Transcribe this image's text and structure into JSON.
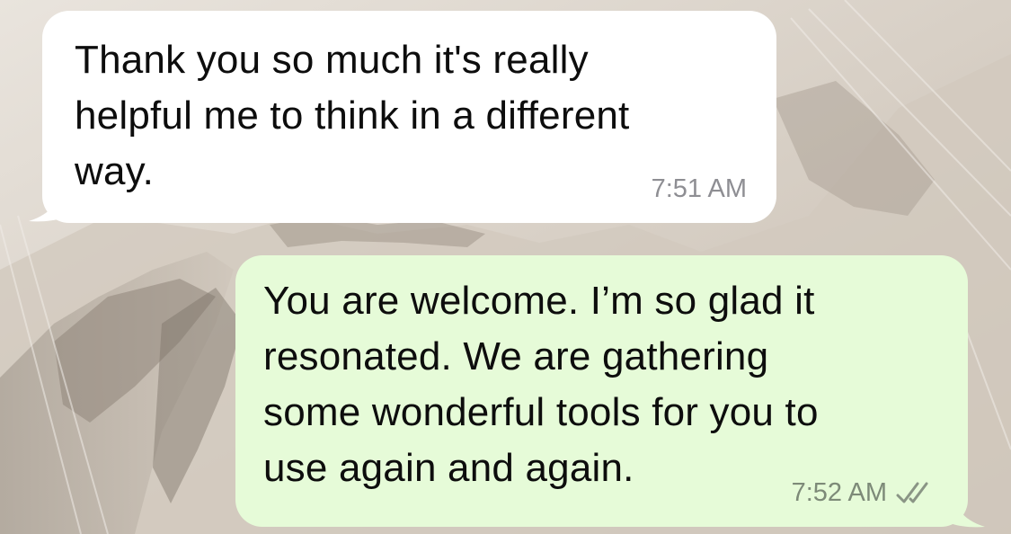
{
  "chat": {
    "messages": [
      {
        "direction": "incoming",
        "text": "Thank you so much it's really\nhelpful me to think in a different\nway.",
        "time": "7:51 AM"
      },
      {
        "direction": "outgoing",
        "text": "You are welcome. I’m so glad it\nresonated. We are gathering\nsome wonderful tools for you to\nuse again and again.",
        "time": "7:52 AM",
        "status_icon": "double-check-icon"
      }
    ]
  },
  "colors": {
    "incoming_bubble": "#ffffff",
    "outgoing_bubble": "#e6fbd8",
    "timestamp": "#8e8e93"
  }
}
